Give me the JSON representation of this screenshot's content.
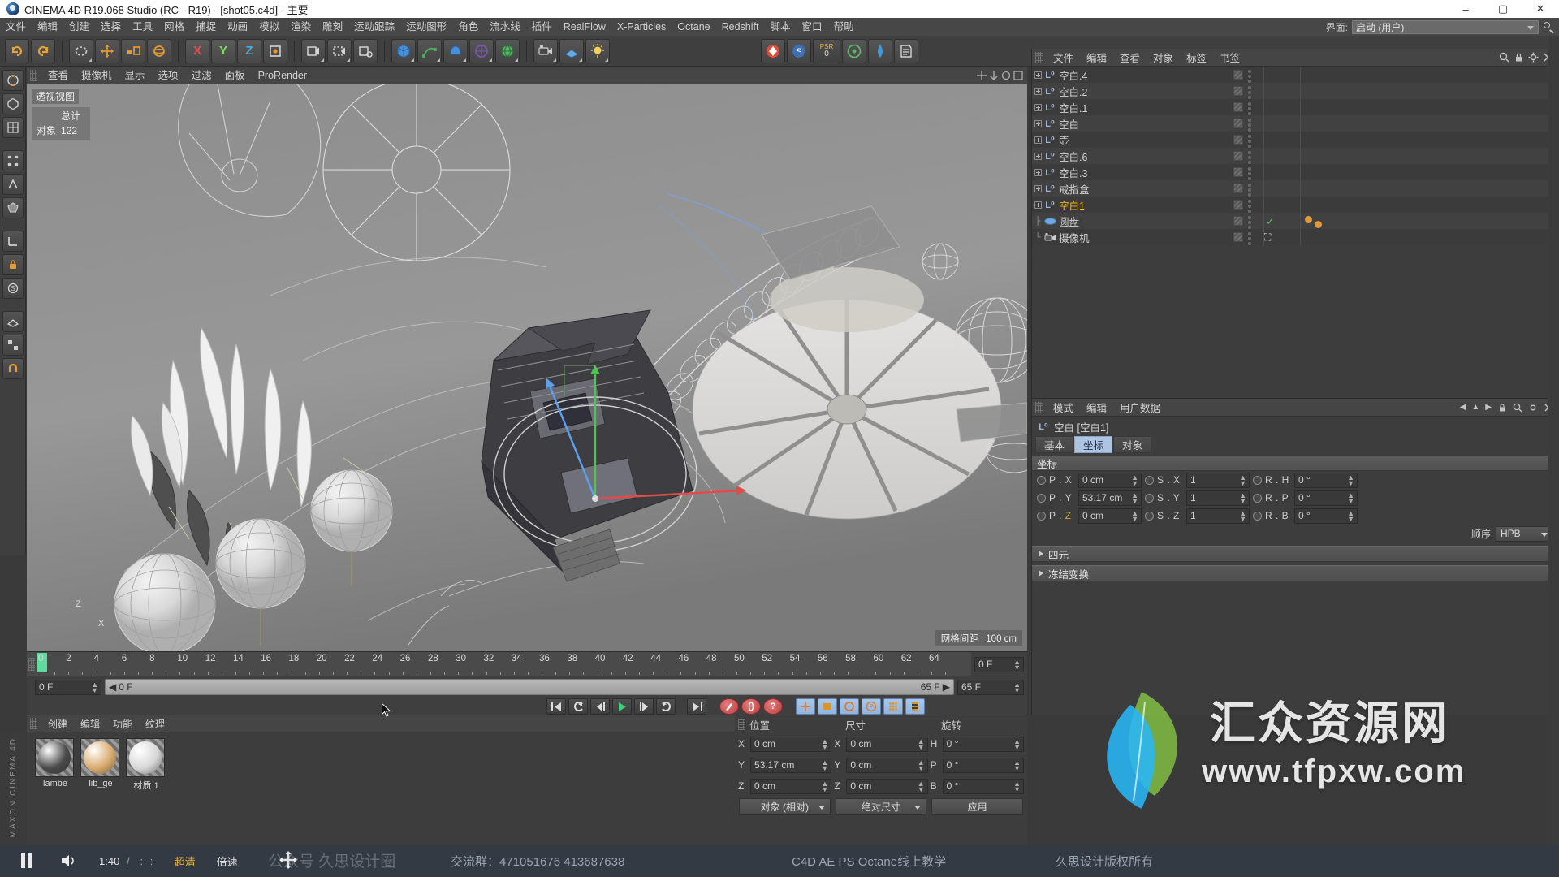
{
  "titlebar": {
    "title": "CINEMA 4D R19.068 Studio (RC - R19) - [shot05.c4d] - 主要",
    "minimize": "–",
    "maximize": "▢",
    "close": "✕"
  },
  "menubar": {
    "items": [
      "文件",
      "编辑",
      "创建",
      "选择",
      "工具",
      "网格",
      "捕捉",
      "动画",
      "模拟",
      "渲染",
      "雕刻",
      "运动跟踪",
      "运动图形",
      "角色",
      "流水线",
      "插件",
      "RealFlow",
      "X-Particles",
      "Octane",
      "Redshift",
      "脚本",
      "窗口",
      "帮助"
    ],
    "interface_label": "界面:",
    "interface_value": "启动 (用户)"
  },
  "toolbar": {
    "psr_label": "PSR",
    "psr_value": "0",
    "axes": [
      "X",
      "Y",
      "Z"
    ],
    "axis_colors": {
      "x": "#e04f4f",
      "y": "#7ede5a",
      "z": "#4fa8e0"
    }
  },
  "viewport": {
    "menu": [
      "查看",
      "摄像机",
      "显示",
      "选项",
      "过滤",
      "面板",
      "ProRender"
    ],
    "view_label": "透视视图",
    "stats": {
      "total_header": "总计",
      "object_label": "对象",
      "object_count": "122"
    },
    "grid_info": "网格间距 : 100 cm",
    "axis_z": "Z",
    "axis_x": "X"
  },
  "timeline": {
    "ticks": [
      "0",
      "2",
      "4",
      "6",
      "8",
      "10",
      "12",
      "14",
      "16",
      "18",
      "20",
      "22",
      "24",
      "26",
      "28",
      "30",
      "32",
      "34",
      "36",
      "38",
      "40",
      "42",
      "44",
      "46",
      "48",
      "50",
      "52",
      "54",
      "56",
      "58",
      "60",
      "62",
      "64"
    ],
    "current_frame": "0 F",
    "range_start": "0 F",
    "range_end": "65 F",
    "end_field": "65 F",
    "right_frame_field": "0 F"
  },
  "materials": {
    "menu": [
      "创建",
      "编辑",
      "功能",
      "纹理"
    ],
    "items": [
      {
        "name": "lambe",
        "color": "#4a4a4a"
      },
      {
        "name": "lib_ge",
        "color": "#d9ab6e"
      },
      {
        "name": "材质.1",
        "color": "#d8d8d8"
      }
    ]
  },
  "coordinates_panel": {
    "headers": [
      "位置",
      "尺寸",
      "旋转"
    ],
    "position": {
      "labels": [
        "X",
        "Y",
        "Z"
      ],
      "values": [
        "0 cm",
        "53.17 cm",
        "0 cm"
      ]
    },
    "size": {
      "labels": [
        "X",
        "Y",
        "Z"
      ],
      "values": [
        "0 cm",
        "0 cm",
        "0 cm"
      ]
    },
    "rotation": {
      "labels": [
        "H",
        "P",
        "B"
      ],
      "values": [
        "0 °",
        "0 °",
        "0 °"
      ]
    },
    "mode_select": "对象 (相对)",
    "size_select": "绝对尺寸",
    "apply_button": "应用"
  },
  "object_manager": {
    "menu": [
      "文件",
      "编辑",
      "查看",
      "对象",
      "标签",
      "书签"
    ],
    "objects": [
      {
        "name": "空白.4",
        "type": "null",
        "selected": false
      },
      {
        "name": "空白.2",
        "type": "null",
        "selected": false
      },
      {
        "name": "空白.1",
        "type": "null",
        "selected": false
      },
      {
        "name": "空白",
        "type": "null",
        "selected": false
      },
      {
        "name": "壶",
        "type": "null",
        "selected": false
      },
      {
        "name": "空白.6",
        "type": "null",
        "selected": false
      },
      {
        "name": "空白.3",
        "type": "null",
        "selected": false
      },
      {
        "name": "戒指盒",
        "type": "null",
        "selected": false
      },
      {
        "name": "空白1",
        "type": "null",
        "selected": true
      },
      {
        "name": "圆盘",
        "type": "disc",
        "selected": false
      },
      {
        "name": "摄像机",
        "type": "camera",
        "selected": false
      }
    ]
  },
  "attribute_manager": {
    "menu": [
      "模式",
      "编辑",
      "用户数据"
    ],
    "object_title": "空白 [空白1]",
    "tabs": [
      {
        "label": "基本",
        "active": false
      },
      {
        "label": "坐标",
        "active": true
      },
      {
        "label": "对象",
        "active": false
      }
    ],
    "section_title": "坐标",
    "rows": [
      {
        "p_label": "P . X",
        "p_value": "0 cm",
        "s_label": "S . X",
        "s_value": "1",
        "r_label": "R . H",
        "r_value": "0 °"
      },
      {
        "p_label": "P . Y",
        "p_value": "53.17 cm",
        "s_label": "S . Y",
        "s_value": "1",
        "r_label": "R . P",
        "r_value": "0 °"
      },
      {
        "p_label": "P . Z",
        "p_value": "0 cm",
        "s_label": "S . Z",
        "s_value": "1",
        "r_label": "R . B",
        "r_value": "0 °"
      }
    ],
    "order_label": "顺序",
    "order_value": "HPB",
    "collapsed_sections": [
      "四元",
      "冻结变换"
    ]
  },
  "player": {
    "time_current": "1:40",
    "time_separator": "/",
    "time_total": "-:--:-",
    "quality": "超清",
    "speed": "倍速",
    "watermark_account": "公众号 久思设计圈",
    "group_text": "交流群：471051676  413687638",
    "course_text": "C4D AE PS Octane线上教学",
    "copyright_text": "久思设计版权所有"
  },
  "watermark": {
    "brand": "汇众资源网",
    "url": "www.tfpxw.com"
  },
  "maxon": {
    "text": "MAXON CINEMA 4D"
  }
}
